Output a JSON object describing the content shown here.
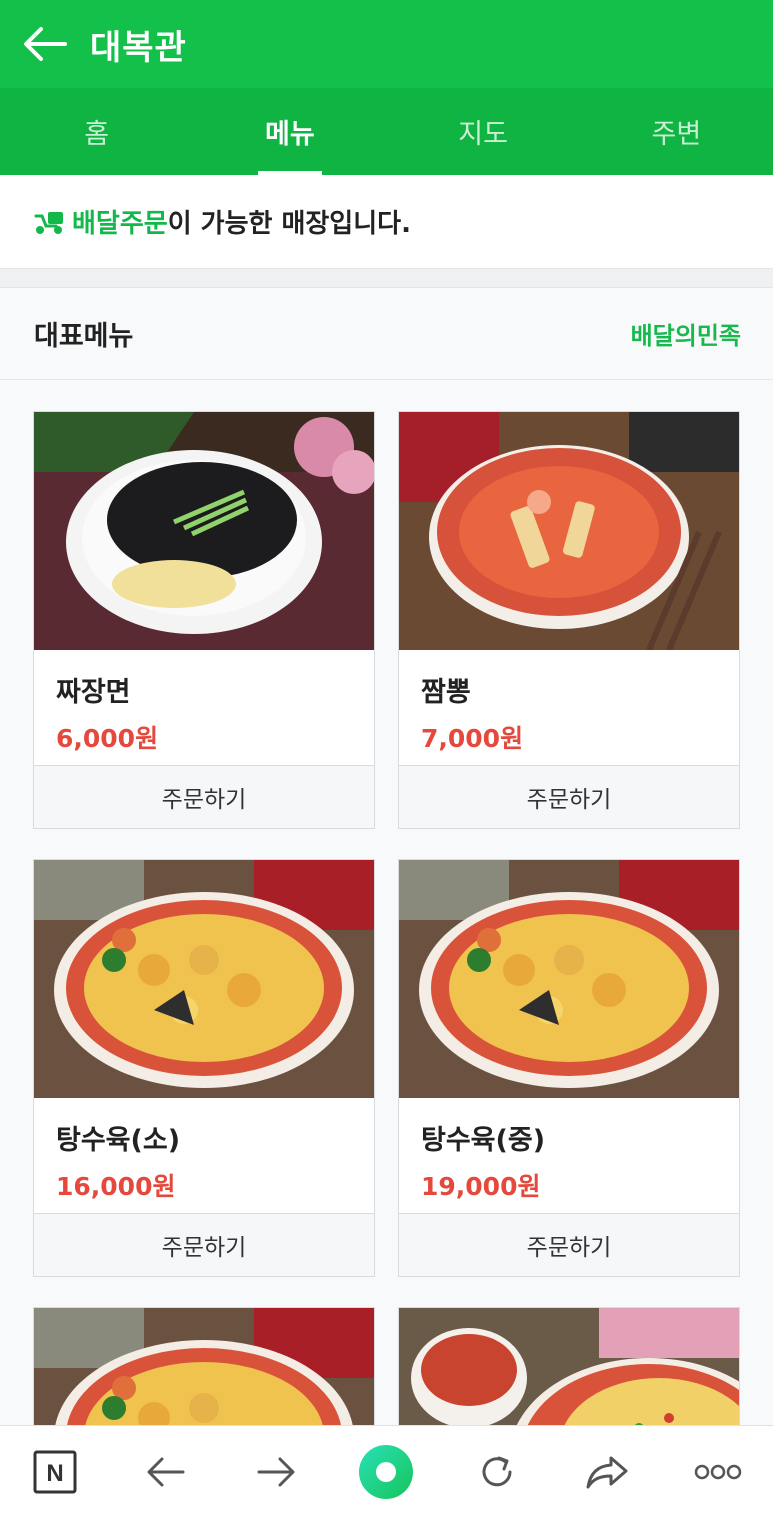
{
  "header": {
    "title": "대복관",
    "back_icon": "arrow-left-icon"
  },
  "tabs": [
    {
      "label": "홈",
      "active": false
    },
    {
      "label": "메뉴",
      "active": true
    },
    {
      "label": "지도",
      "active": false
    },
    {
      "label": "주변",
      "active": false
    }
  ],
  "notice": {
    "icon": "delivery-scooter-icon",
    "highlight": "배달주문",
    "text": "이 가능한 매장입니다."
  },
  "section": {
    "title": "대표메뉴",
    "link": "배달의민족"
  },
  "menu": [
    {
      "name": "짜장면",
      "price": "6,000원",
      "order_label": "주문하기"
    },
    {
      "name": "짬뽕",
      "price": "7,000원",
      "order_label": "주문하기"
    },
    {
      "name": "탕수육(소)",
      "price": "16,000원",
      "order_label": "주문하기"
    },
    {
      "name": "탕수육(중)",
      "price": "19,000원",
      "order_label": "주문하기"
    }
  ],
  "bottom_bar": {
    "icons": [
      "naver-n-icon",
      "back-arrow-icon",
      "forward-arrow-icon",
      "green-dot-icon",
      "refresh-icon",
      "share-icon",
      "more-icon"
    ],
    "naver_letter": "N"
  },
  "colors": {
    "brand_green": "#12c04a",
    "tab_green": "#0fb443",
    "price_red": "#e5483d",
    "link_green": "#17b94d"
  }
}
